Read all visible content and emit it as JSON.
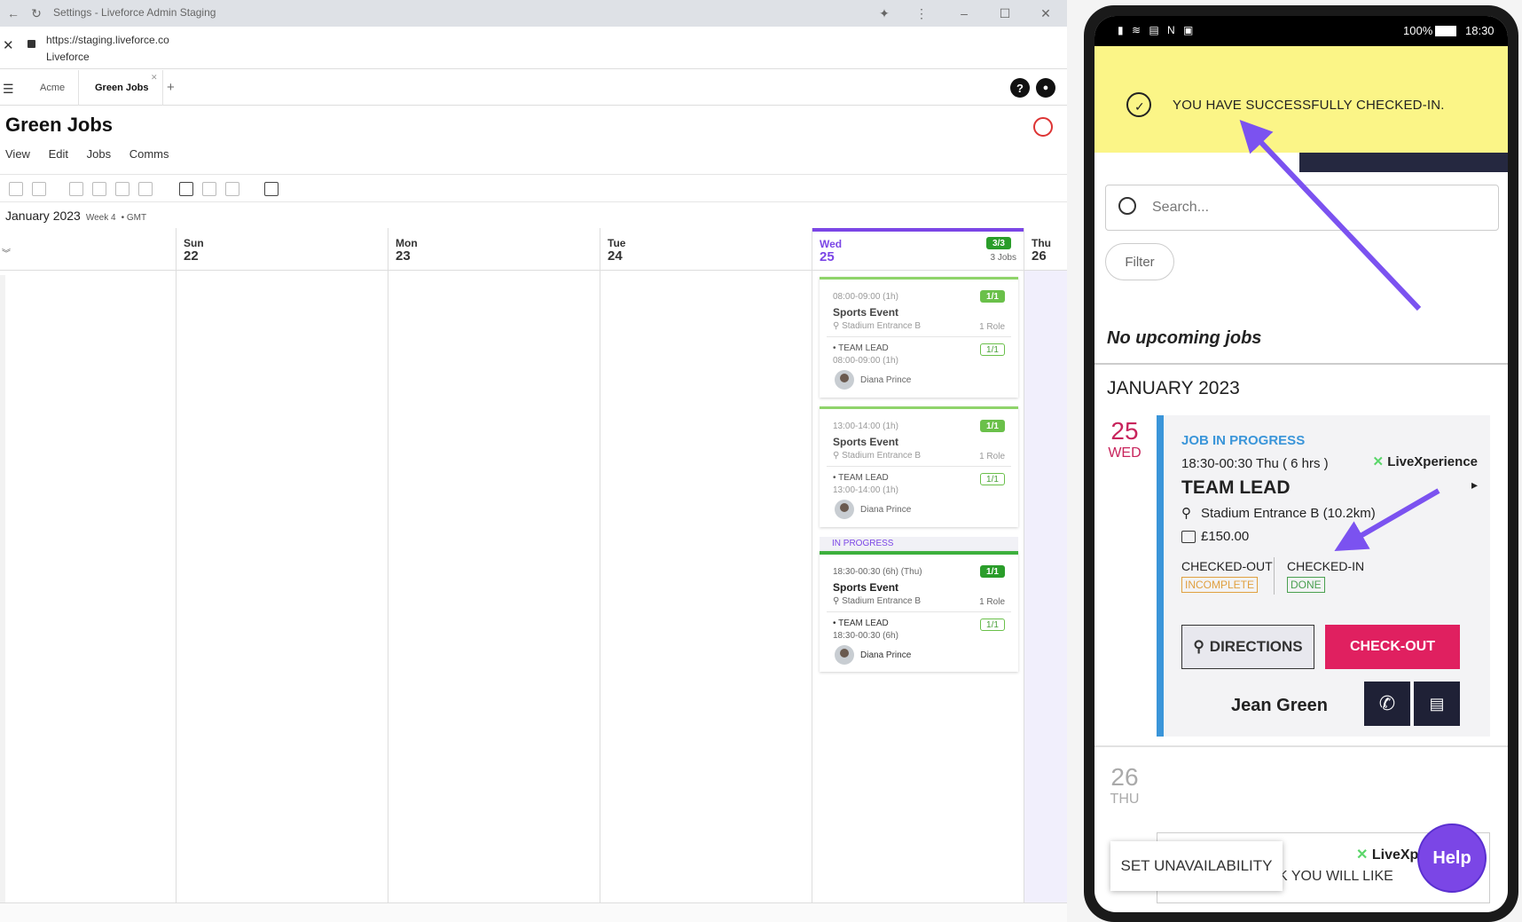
{
  "browser": {
    "title": "Settings - Liveforce Admin Staging",
    "url": "https://staging.liveforce.co",
    "site_name": "Liveforce",
    "tabs": [
      "Acme",
      "Green Jobs"
    ],
    "add_tab": "+",
    "help_glyph": "?",
    "page_title": "Green Jobs",
    "menu": [
      "View",
      "Edit",
      "Jobs",
      "Comms"
    ],
    "month": "January 2023",
    "week": "Week 4",
    "timezone": "• GMT"
  },
  "calendar": {
    "days": [
      {
        "name": "Sun",
        "num": "22"
      },
      {
        "name": "Mon",
        "num": "23"
      },
      {
        "name": "Tue",
        "num": "24"
      },
      {
        "name": "Wed",
        "num": "25"
      },
      {
        "name": "Thu",
        "num": "26"
      }
    ],
    "wed_badge": "3/3",
    "wed_jobs": "3 Jobs",
    "jobs": [
      {
        "time": "08:00-09:00 (1h)",
        "badge": "1/1",
        "name": "Sports Event",
        "location": "Stadium Entrance B",
        "roles": "1 Role",
        "role": "• TEAM LEAD",
        "role_badge": "1/1",
        "role_time": "08:00-09:00 (1h)",
        "person": "Diana Prince"
      },
      {
        "time": "13:00-14:00 (1h)",
        "badge": "1/1",
        "name": "Sports Event",
        "location": "Stadium Entrance B",
        "roles": "1 Role",
        "role": "• TEAM LEAD",
        "role_badge": "1/1",
        "role_time": "13:00-14:00 (1h)",
        "person": "Diana Prince"
      },
      {
        "status": "IN PROGRESS",
        "time": "18:30-00:30 (6h) (Thu)",
        "badge": "1/1",
        "name": "Sports Event",
        "location": "Stadium Entrance B",
        "roles": "1 Role",
        "role": "• TEAM LEAD",
        "role_badge": "1/1",
        "role_time": "18:30-00:30 (6h)",
        "person": "Diana Prince"
      }
    ]
  },
  "phone": {
    "battery": "100%",
    "clock": "18:30",
    "banner": "YOU HAVE SUCCESSFULLY CHECKED-IN.",
    "search_placeholder": "Search...",
    "filter": "Filter",
    "no_upcoming": "No upcoming jobs",
    "month": "JANUARY 2023",
    "day1_num": "25",
    "day1_name": "WED",
    "job_status": "JOB IN PROGRESS",
    "job_time": "18:30-00:30 Thu ( 6 hrs )",
    "brand": "LiveXperience",
    "job_role": "TEAM LEAD",
    "job_location": "Stadium Entrance B (10.2km)",
    "job_pay": "£150.00",
    "checked_out": "CHECKED-OUT",
    "checked_out_status": "INCOMPLETE",
    "checked_in": "CHECKED-IN",
    "checked_in_status": "DONE",
    "directions": "DIRECTIONS",
    "checkout": "CHECK-OUT",
    "manager": "Jean Green",
    "day2_num": "26",
    "day2_name": "THU",
    "card2_text": "K YOU WILL LIKE",
    "card2_brand": "LiveXp",
    "set_unavailability": "SET UNAVAILABILITY",
    "help": "Help"
  },
  "colors": {
    "accent": "#7b46e6",
    "checkout": "#e02060",
    "banner": "#fbf587",
    "progress_blue": "#3a95d9",
    "green": "#6ac04a"
  }
}
